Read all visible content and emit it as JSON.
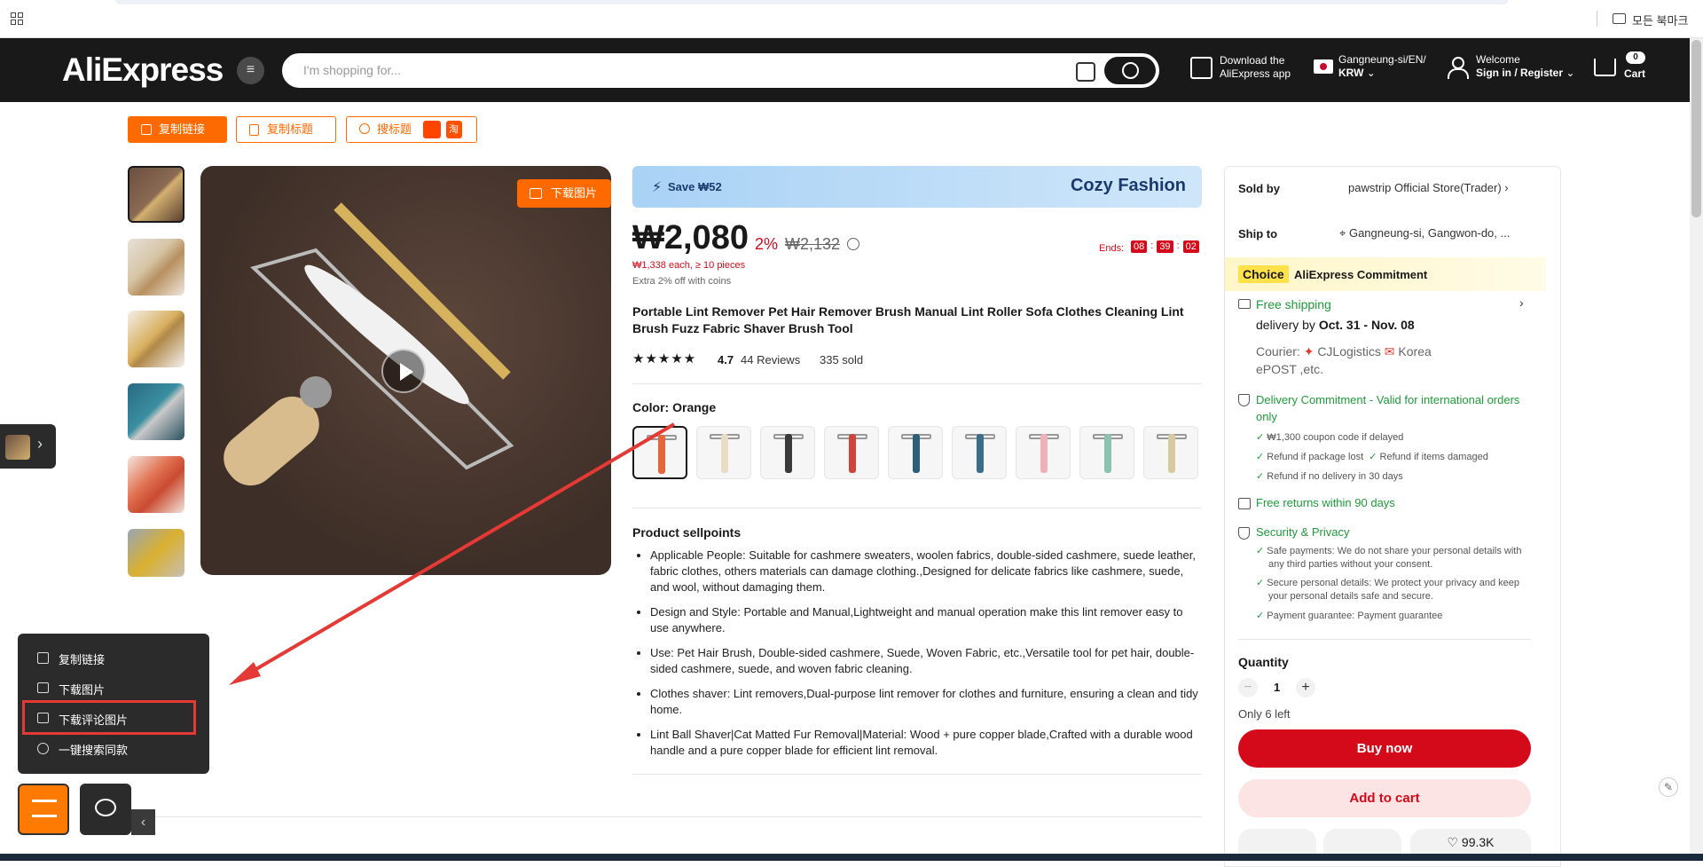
{
  "bookmark_bar": {
    "folder_label": "모든 북마크"
  },
  "header": {
    "logo": "AliExpress",
    "search_placeholder": "I'm shopping for...",
    "download_app": [
      "Download the",
      "AliExpress app"
    ],
    "locale": [
      "Gangneung-si/EN/",
      "KRW"
    ],
    "welcome": "Welcome",
    "signin": "Sign in / Register",
    "cart_label": "Cart",
    "cart_count": "0"
  },
  "toolbar": {
    "copy_link": "复制链接",
    "copy_title": "复制标题",
    "search_title": "搜标题",
    "tb_badge": "淘"
  },
  "main_image": {
    "download_label": "下载图片"
  },
  "product": {
    "banner_save": "Save ₩52",
    "banner_brand": "Cozy Fashion",
    "price": "₩2,080",
    "discount": "2%",
    "old_price": "₩2,132",
    "bulk": "₩1,338 each, ≥ 10 pieces",
    "coins": "Extra 2% off with coins",
    "ends_label": "Ends:",
    "timer": [
      "08",
      "39",
      "02"
    ],
    "title": "Portable Lint Remover Pet Hair Remover Brush Manual Lint Roller Sofa Clothes Cleaning Lint Brush Fuzz Fabric Shaver Brush Tool",
    "rating": "4.7",
    "reviews": "44 Reviews",
    "sold": "335 sold",
    "color_label": "Color: Orange",
    "sellpoints_title": "Product sellpoints",
    "sellpoints": [
      "Applicable People: Suitable for cashmere sweaters, woolen fabrics, double-sided cashmere, suede leather, fabric clothes, others materials can damage clothing.,Designed for delicate fabrics like cashmere, suede, and wool, without damaging them.",
      "Design and Style: Portable and Manual,Lightweight and manual operation make this lint remover easy to use anywhere.",
      "Use: Pet Hair Brush, Double-sided cashmere, Suede, Woven Fabric, etc.,Versatile tool for pet hair, double-sided cashmere, suede, and woven fabric cleaning.",
      "Clothes shaver: Lint removers,Dual-purpose lint remover for clothes and furniture, ensuring a clean and tidy home.",
      "Lint Ball Shaver|Cat Matted Fur Removal|Material: Wood + pure copper blade,Crafted with a durable wood handle and a pure copper blade for efficient lint removal."
    ],
    "swatch_colors": [
      "#e8643a",
      "#e8dcc4",
      "#3a3a3a",
      "#d0453a",
      "#2e5f7a",
      "#3a6e8a",
      "#f0b0b8",
      "#8ac4b0",
      "#d9c9a0"
    ]
  },
  "sidebar": {
    "sold_by_label": "Sold by",
    "store": "pawstrip Official Store(Trader)",
    "ship_to_label": "Ship to",
    "ship_to": "Gangneung-si, Gangwon-do, ...",
    "choice": "Choice",
    "commitment": "AliExpress Commitment",
    "free_shipping": "Free shipping",
    "delivery_prefix": "delivery by",
    "delivery_date": "Oct. 31 - Nov. 08",
    "courier_label": "Courier:",
    "courier_1": "CJLogistics",
    "courier_2": "Korea",
    "courier_3": "ePOST ,etc.",
    "delivery_commit": "Delivery Commitment - Valid for international orders only",
    "commit_items": [
      "₩1,300 coupon code if delayed",
      "Refund if package lost",
      "Refund if items damaged",
      "Refund if no delivery in 30 days"
    ],
    "free_returns": "Free returns within 90 days",
    "security": "Security & Privacy",
    "security_items": [
      "Safe payments: We do not share your personal details with any third parties without your consent.",
      "Secure personal details: We protect your privacy and keep your personal details safe and secure.",
      "Payment guarantee: Payment guarantee"
    ],
    "quantity_label": "Quantity",
    "quantity": "1",
    "only_left": "Only 6 left",
    "buy_now": "Buy now",
    "add_to_cart": "Add to cart",
    "wishlist": "99.3K"
  },
  "popup": {
    "items": [
      "复制链接",
      "下载图片",
      "下载评论图片",
      "一键搜索同款"
    ]
  }
}
